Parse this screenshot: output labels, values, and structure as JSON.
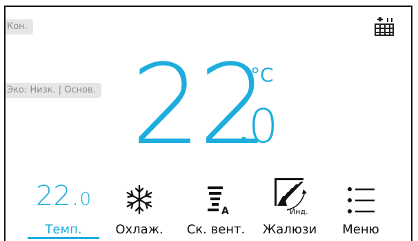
{
  "header": {
    "mode_pill": "Кон.",
    "eco_pill": "Эко: Низк. | Основ.",
    "schedule_icon": "schedule-grid-icon"
  },
  "display": {
    "temp_int": "22",
    "temp_frac": "0",
    "unit": "°C"
  },
  "tabs": [
    {
      "label": "Темп.",
      "value_int": "22.",
      "value_frac": "0",
      "active": true
    },
    {
      "label": "Охлаж.",
      "icon": "snowflake-icon"
    },
    {
      "label": "Ск. вент.",
      "icon": "fan-speed-auto-icon",
      "badge": "A"
    },
    {
      "label": "Жалюзи",
      "icon": "louver-icon",
      "badge": "Инд."
    },
    {
      "label": "Меню",
      "icon": "menu-list-icon"
    }
  ],
  "colors": {
    "accent": "#1eaede",
    "text": "#111111"
  }
}
